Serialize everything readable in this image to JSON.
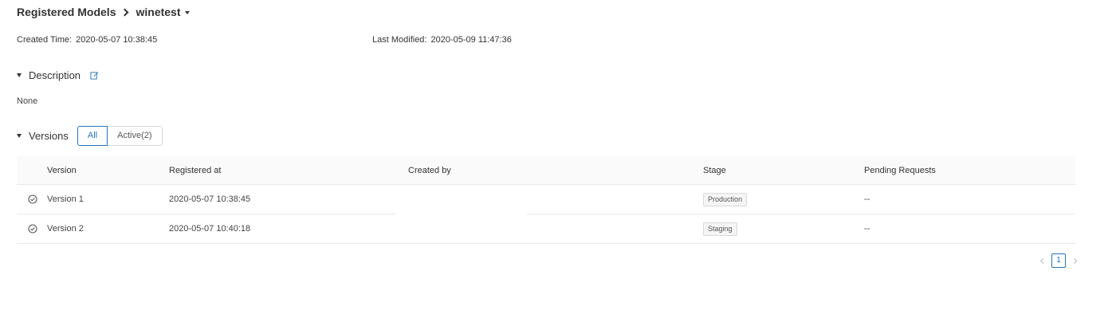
{
  "breadcrumb": {
    "root": "Registered Models",
    "current": "winetest"
  },
  "meta": {
    "created_label": "Created Time",
    "created_value": "2020-05-07 10:38:45",
    "modified_label": "Last Modified",
    "modified_value": "2020-05-09 11:47:36"
  },
  "description": {
    "heading": "Description",
    "text": "None",
    "icon": "edit-icon"
  },
  "versions": {
    "heading": "Versions",
    "filter_all": "All",
    "filter_active": "Active(2)",
    "columns": [
      "Version",
      "Registered at",
      "Created by",
      "Stage",
      "Pending Requests"
    ],
    "rows": [
      {
        "version": "Version 1",
        "registered_at": "2020-05-07 10:38:45",
        "created_by": "",
        "stage": "Production",
        "pending": "--"
      },
      {
        "version": "Version 2",
        "registered_at": "2020-05-07 10:40:18",
        "created_by": "",
        "stage": "Staging",
        "pending": "--"
      }
    ]
  },
  "pagination": {
    "current": "1"
  },
  "colors": {
    "accent": "#2374bb",
    "border": "#e8e8e8",
    "header_bg": "#fafafa"
  }
}
